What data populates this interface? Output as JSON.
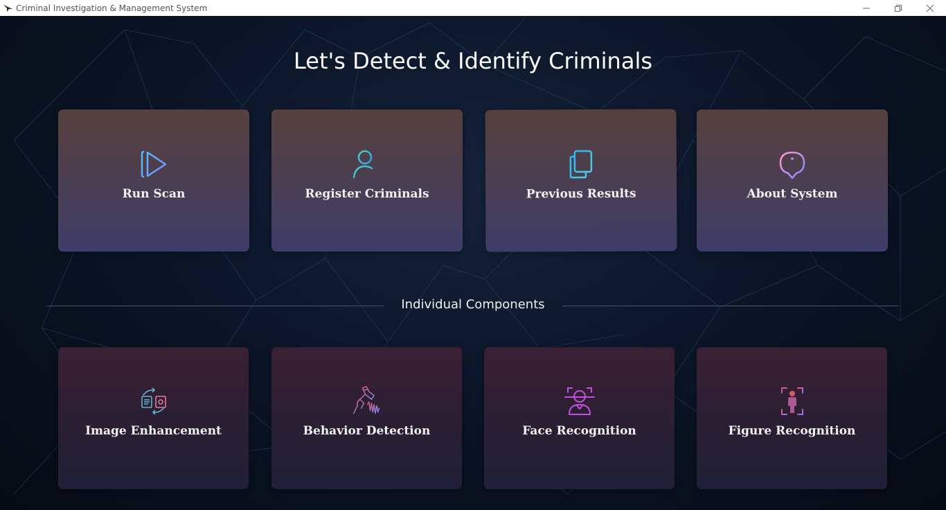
{
  "window": {
    "title": "Criminal Investigation & Management System",
    "icon": "app-bird-icon",
    "controls": [
      "minimize-icon",
      "restore-icon",
      "close-icon"
    ]
  },
  "main": {
    "heading": "Let's Detect & Identify Criminals",
    "primary_cards": [
      {
        "label": "Run Scan",
        "icon": "play-icon",
        "color": "#4fc3f7"
      },
      {
        "label": "Register Criminals",
        "icon": "add-user-icon",
        "color": "#4dd0b0"
      },
      {
        "label": "Previous Results",
        "icon": "documents-icon",
        "color": "#29b6f6"
      },
      {
        "label": "About System",
        "icon": "info-icon",
        "color": "#c78bff"
      }
    ],
    "section_title": "Individual Components",
    "component_cards": [
      {
        "label": "Image Enhancement",
        "icon": "image-enhancement-icon",
        "color": "#5fb3c9"
      },
      {
        "label": "Behavior Detection",
        "icon": "behavior-detection-icon",
        "color": "#e05a7a"
      },
      {
        "label": "Face Recognition",
        "icon": "face-recognition-icon",
        "color": "#c250e0"
      },
      {
        "label": "Figure Recognition",
        "icon": "figure-recognition-icon",
        "color": "#e05a6a"
      }
    ]
  },
  "colors": {
    "background": "#0a0f1c",
    "card_top_gradient_start": "#56403f",
    "card_top_gradient_end": "#3e3d6a",
    "card_bottom_gradient_start": "#3a1f33",
    "card_bottom_gradient_end": "#1f2038"
  }
}
